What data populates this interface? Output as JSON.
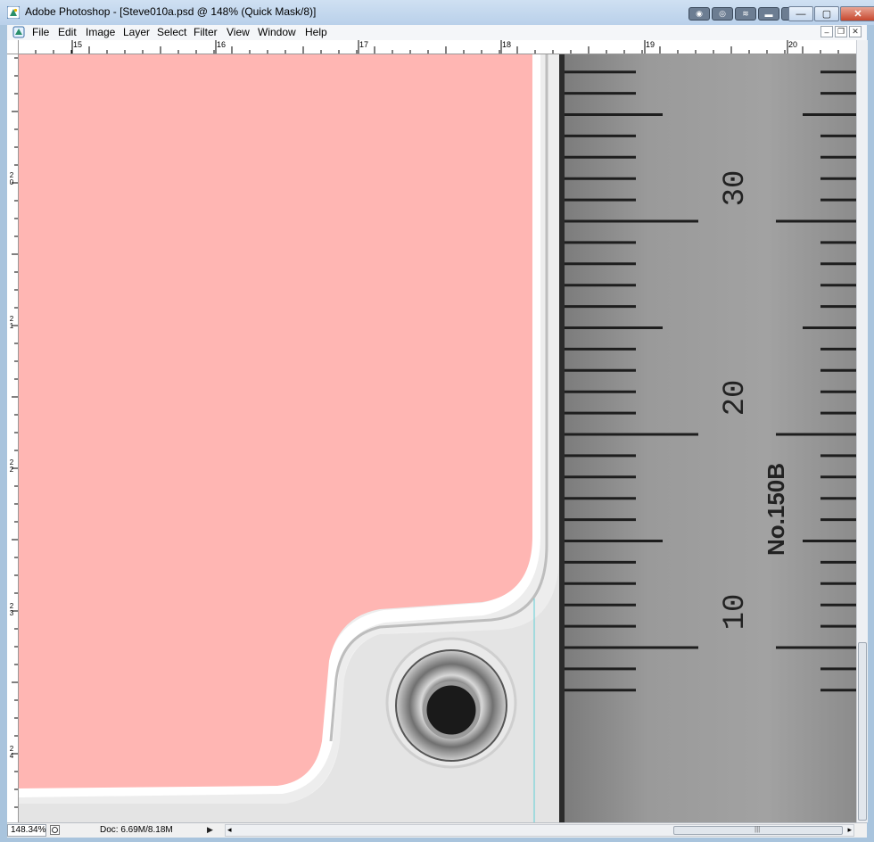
{
  "window": {
    "title": "Adobe Photoshop - [Steve010a.psd @ 148% (Quick Mask/8)]",
    "minimize_glyph": "▭",
    "maximize_glyph": "▢",
    "close_glyph": "✕"
  },
  "menu": {
    "items": [
      "File",
      "Edit",
      "Image",
      "Layer",
      "Select",
      "Filter",
      "View",
      "Window",
      "Help"
    ]
  },
  "rulers": {
    "top_labels": [
      "15",
      "16",
      "17",
      "18",
      "19",
      "20"
    ],
    "left_labels": [
      "2 0",
      "2 1",
      "2 2",
      "2 3",
      "2 4"
    ]
  },
  "status": {
    "zoom": "148.34%",
    "doc_info": "Doc: 6.69M/8.18M"
  },
  "image": {
    "ruler_numbers": [
      "30",
      "20",
      "10"
    ],
    "ruler_model": "No.150B",
    "mask_color": "#ffb6b3"
  },
  "colors": {
    "titlebar": "#b9d0ea",
    "menubar": "#f4f6f9"
  }
}
